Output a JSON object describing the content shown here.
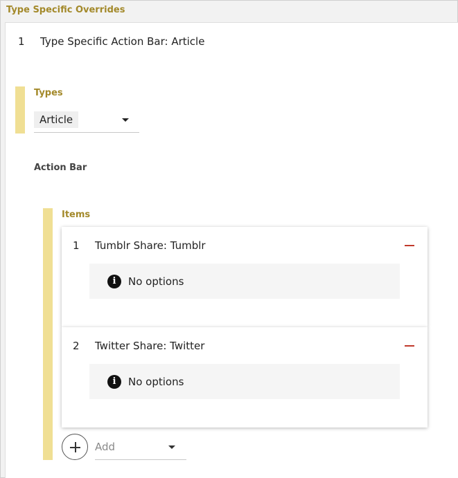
{
  "section": {
    "title": "Type Specific Overrides"
  },
  "override": {
    "index": "1",
    "title": "Type Specific Action Bar: Article",
    "types_label": "Types",
    "types_value": "Article",
    "action_bar_label": "Action Bar",
    "items_label": "Items",
    "items": [
      {
        "index": "1",
        "label": "Tumblr Share: Tumblr",
        "options_text": "No options"
      },
      {
        "index": "2",
        "label": "Twitter Share: Twitter",
        "options_text": "No options"
      }
    ],
    "add_placeholder": "Add"
  },
  "colors": {
    "accent": "#a3892a",
    "accent_bar": "#f0df94",
    "remove": "#c0392b"
  },
  "icons": {
    "info": "info-circle-icon",
    "remove": "minus-icon",
    "add": "plus-icon",
    "dropdown": "chevron-down-icon"
  }
}
